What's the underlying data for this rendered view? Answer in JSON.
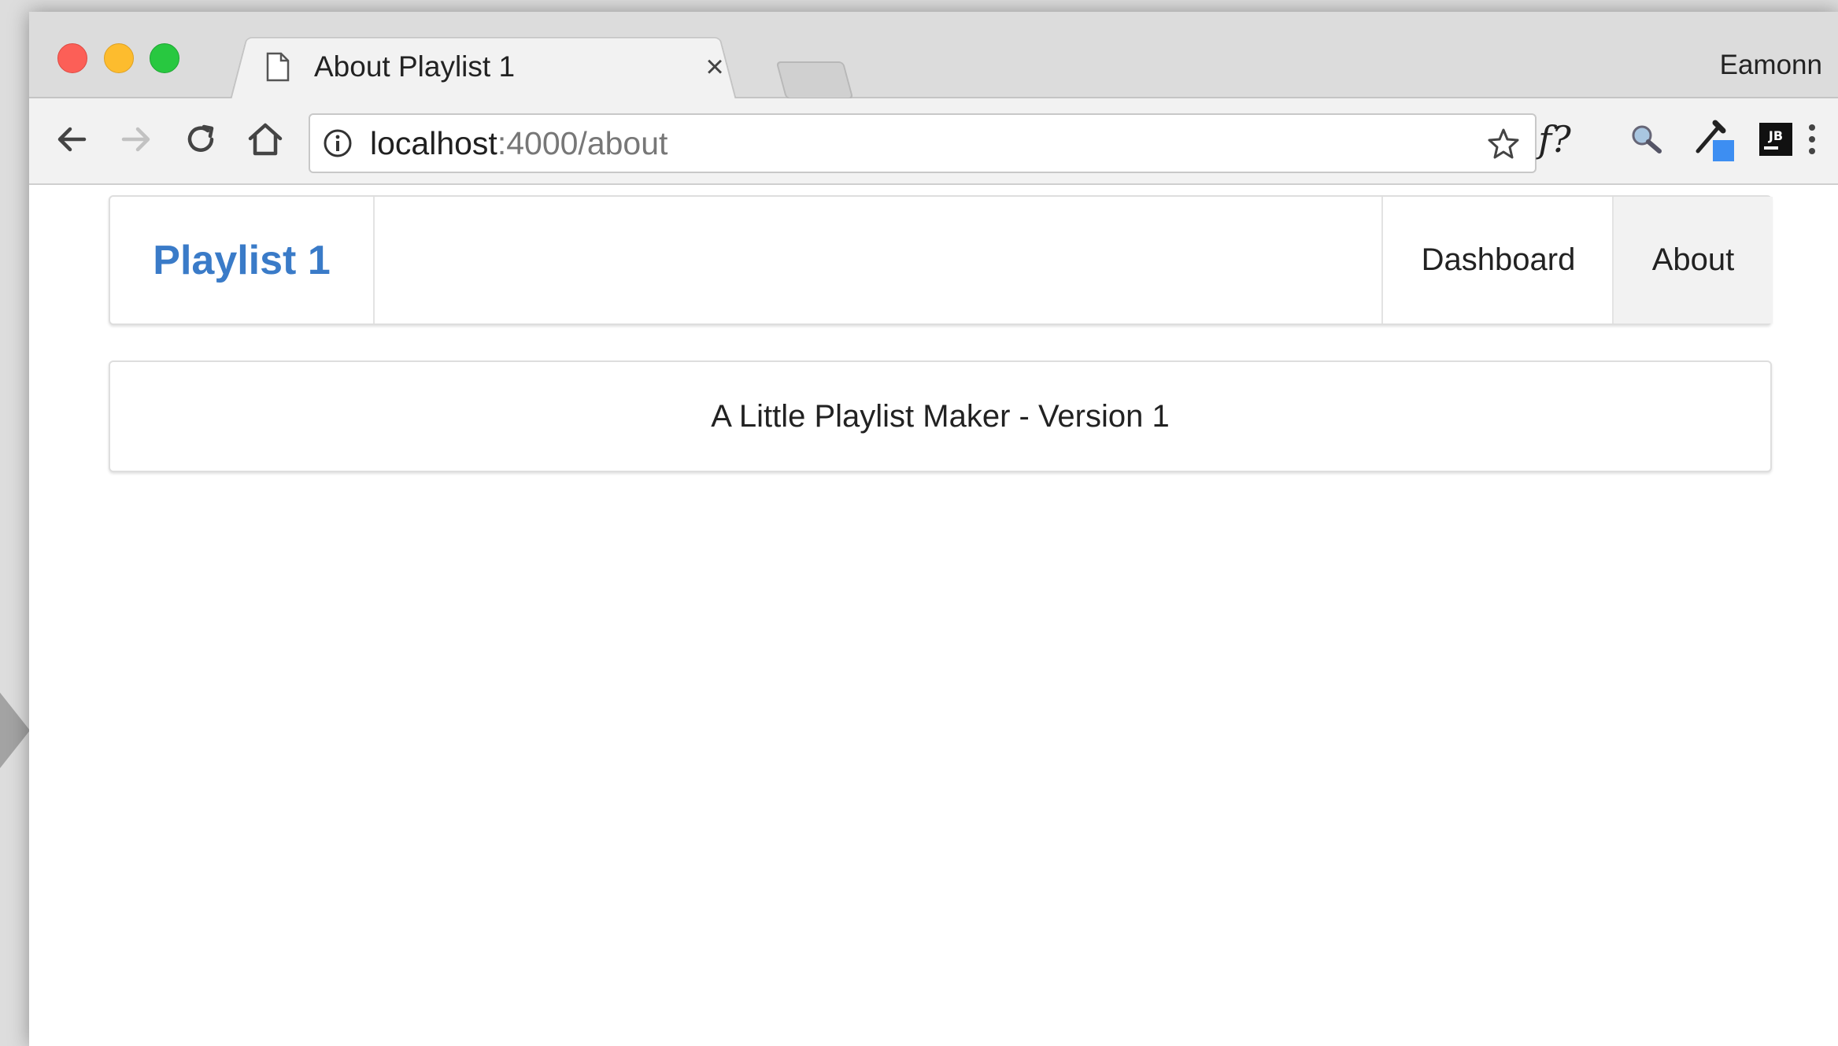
{
  "browser": {
    "tab_title": "About Playlist 1",
    "tab_close": "×",
    "profile_name": "Eamonn",
    "url_host": "localhost",
    "url_rest": ":4000/about",
    "ext_f_label": "f?"
  },
  "navbar": {
    "brand": "Playlist 1",
    "items": [
      {
        "label": "Dashboard",
        "active": false
      },
      {
        "label": "About",
        "active": true
      }
    ]
  },
  "content": {
    "about_text": "A Little Playlist Maker - Version 1"
  },
  "colors": {
    "brand": "#3a7bc8",
    "active_nav_bg": "#f2f2f2"
  }
}
